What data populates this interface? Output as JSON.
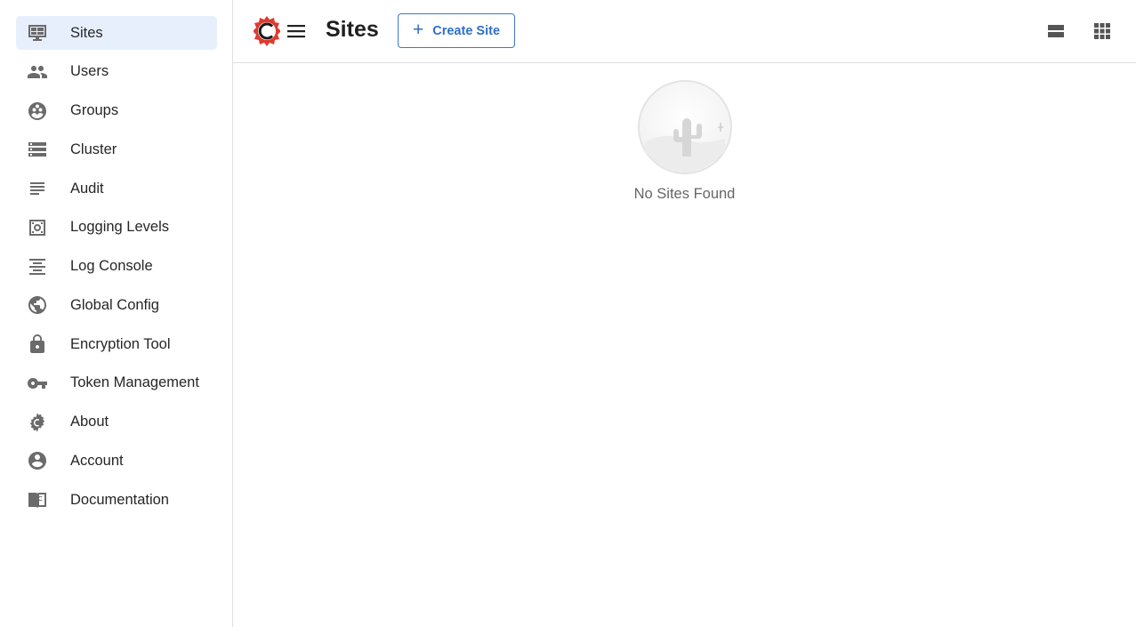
{
  "sidebar": {
    "items": [
      {
        "label": "Sites",
        "icon": "sites-icon",
        "active": true
      },
      {
        "label": "Users",
        "icon": "users-icon"
      },
      {
        "label": "Groups",
        "icon": "groups-icon"
      },
      {
        "label": "Cluster",
        "icon": "cluster-icon"
      },
      {
        "label": "Audit",
        "icon": "audit-icon"
      },
      {
        "label": "Logging Levels",
        "icon": "logging-levels-icon"
      },
      {
        "label": "Log Console",
        "icon": "log-console-icon"
      },
      {
        "label": "Global Config",
        "icon": "globe-icon"
      },
      {
        "label": "Encryption Tool",
        "icon": "lock-icon"
      },
      {
        "label": "Token Management",
        "icon": "key-icon"
      },
      {
        "label": "About",
        "icon": "crafter-gear-icon"
      },
      {
        "label": "Account",
        "icon": "account-icon"
      },
      {
        "label": "Documentation",
        "icon": "documentation-icon"
      }
    ]
  },
  "header": {
    "title": "Sites",
    "create_button_label": "Create Site",
    "create_button_icon": "plus-icon",
    "brand_color": "#e03a2f",
    "accent_color": "#2f6fc9"
  },
  "main": {
    "empty_message": "No Sites Found"
  }
}
